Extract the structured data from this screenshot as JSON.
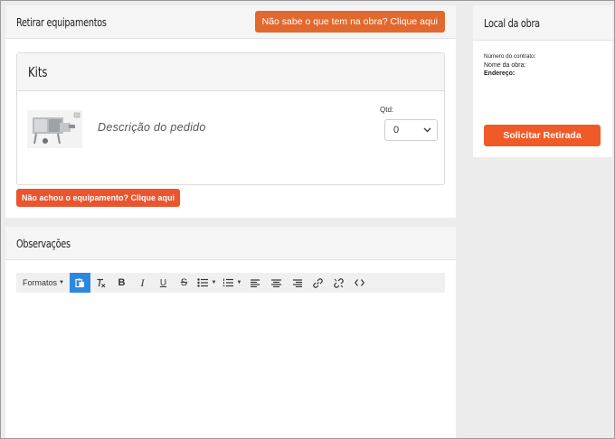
{
  "retirar": {
    "title": "Retirar equipamentos",
    "help_button": "Não sabe o que tem na obra? Clique aqui",
    "kits": {
      "title": "Kits",
      "item_description": "Descrição do pedido",
      "qty_label": "Qtd:",
      "qty_value": "0"
    },
    "not_found_button": "Não achou o equipamento? Clique aqui"
  },
  "observacoes": {
    "title": "Observações",
    "toolbar": {
      "formats_label": "Formatos"
    }
  },
  "local": {
    "title": "Local da obra",
    "contract_label": "Número do contrato:",
    "name_label": "Nome da obra:",
    "address_label": "Endereço:",
    "submit_button": "Solicitar Retirada"
  },
  "colors": {
    "accent": "#e2692e",
    "accent_button": "#f05a28",
    "editor_active": "#2b87e0"
  }
}
